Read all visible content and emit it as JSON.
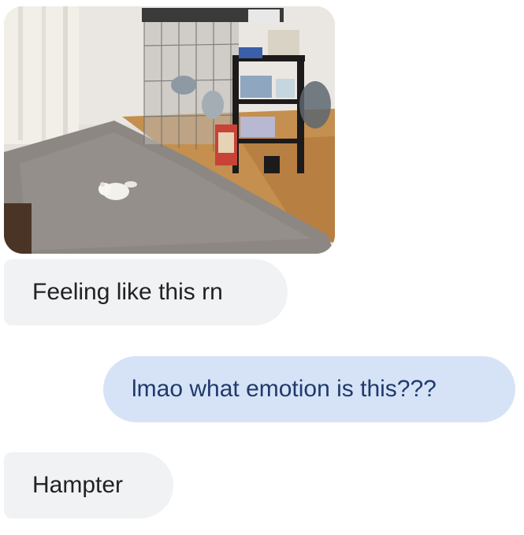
{
  "conversation": {
    "messages": [
      {
        "direction": "received",
        "type": "image",
        "image_subject": "chinchilla on grey rug near cage"
      },
      {
        "direction": "received",
        "type": "text",
        "text": "Feeling like this rn"
      },
      {
        "direction": "sent",
        "type": "text",
        "text": "lmao what emotion is this???"
      },
      {
        "direction": "received",
        "type": "text",
        "text": "Hampter"
      }
    ]
  },
  "colors": {
    "received_bubble": "#f0f2f4",
    "received_text": "#222222",
    "sent_bubble": "#d6e3f7",
    "sent_text": "#1f3a6b",
    "background": "#ffffff"
  }
}
